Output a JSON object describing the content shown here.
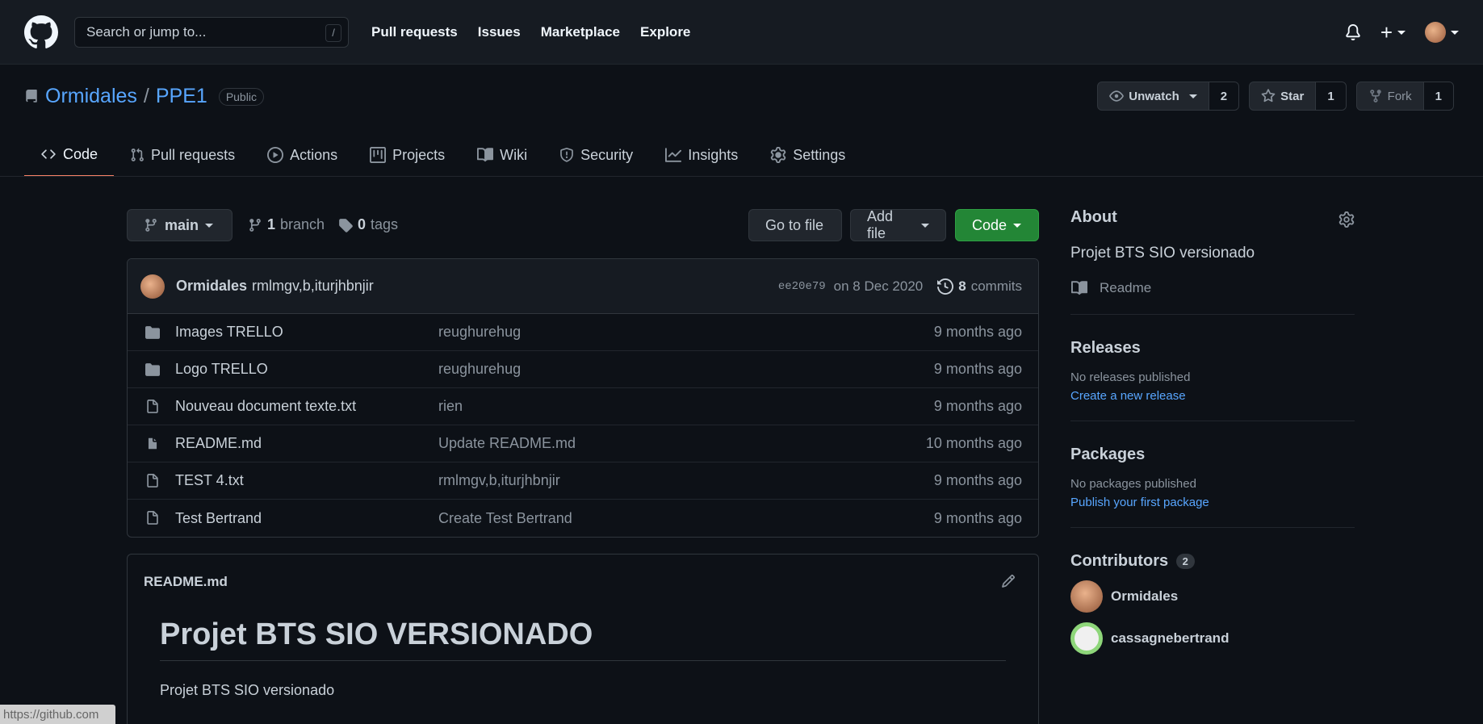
{
  "header": {
    "search_placeholder": "Search or jump to...",
    "search_shortcut": "/",
    "nav": [
      "Pull requests",
      "Issues",
      "Marketplace",
      "Explore"
    ]
  },
  "repo": {
    "owner": "Ormidales",
    "separator": "/",
    "name": "PPE1",
    "visibility": "Public",
    "unwatch_label": "Unwatch",
    "watch_count": "2",
    "star_label": "Star",
    "star_count": "1",
    "fork_label": "Fork",
    "fork_count": "1"
  },
  "tabs": [
    "Code",
    "Pull requests",
    "Actions",
    "Projects",
    "Wiki",
    "Security",
    "Insights",
    "Settings"
  ],
  "toolbar": {
    "branch": "main",
    "branch_count": "1",
    "branch_word": "branch",
    "tag_count": "0",
    "tag_word": "tags",
    "go_to_file": "Go to file",
    "add_file": "Add file",
    "code": "Code"
  },
  "commit": {
    "author": "Ormidales",
    "message": "rmlmgv,b,iturjhbnjir",
    "sha": "ee20e79",
    "date": "on 8 Dec 2020",
    "count": "8",
    "count_word": "commits"
  },
  "files": [
    {
      "type": "folder",
      "name": "Images TRELLO",
      "message": "reughurehug",
      "age": "9 months ago"
    },
    {
      "type": "folder",
      "name": "Logo TRELLO",
      "message": "reughurehug",
      "age": "9 months ago"
    },
    {
      "type": "file",
      "name": "Nouveau document texte.txt",
      "message": "rien",
      "age": "9 months ago"
    },
    {
      "type": "file",
      "name": "README.md",
      "message": "Update README.md",
      "age": "10 months ago"
    },
    {
      "type": "file",
      "name": "TEST 4.txt",
      "message": "rmlmgv,b,iturjhbnjir",
      "age": "9 months ago"
    },
    {
      "type": "file",
      "name": "Test Bertrand",
      "message": "Create Test Bertrand",
      "age": "9 months ago"
    }
  ],
  "readme": {
    "filename": "README.md",
    "heading": "Projet BTS SIO VERSIONADO",
    "body": "Projet BTS SIO versionado"
  },
  "sidebar": {
    "about_title": "About",
    "description": "Projet BTS SIO versionado",
    "readme_link": "Readme",
    "releases_title": "Releases",
    "releases_none": "No releases published",
    "releases_link": "Create a new release",
    "packages_title": "Packages",
    "packages_none": "No packages published",
    "packages_link": "Publish your first package",
    "contributors_title": "Contributors",
    "contributors_count": "2",
    "contributors": [
      {
        "name": "Ormidales",
        "avatar_color": "#c98a62"
      },
      {
        "name": "cassagnebertrand",
        "avatar_color": "#8ed67a"
      }
    ]
  },
  "status_bar": "https://github.com",
  "colors": {
    "background": "#0d1117",
    "header": "#161b22",
    "link": "#58a6ff",
    "primary_button": "#238636",
    "tab_underline": "#f78166"
  }
}
